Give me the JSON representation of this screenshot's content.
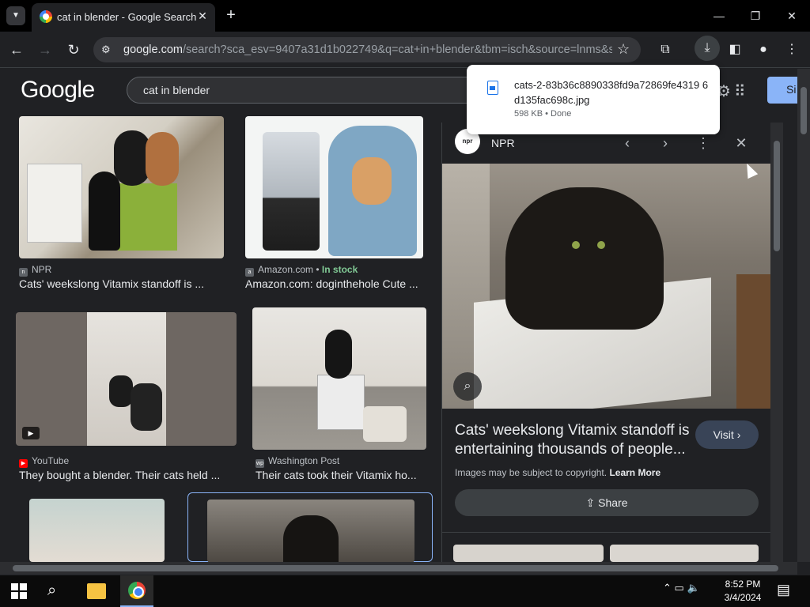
{
  "browser": {
    "tab_title": "cat in blender - Google Search",
    "url_host": "google.com",
    "url_path": "/search?sca_esv=9407a31d1b022749&q=cat+in+blender&tbm=isch&source=lnms&s..."
  },
  "page": {
    "logo": "Google",
    "query": "cat in blender",
    "signin_label": "Si"
  },
  "results": [
    {
      "source": "NPR",
      "source_icon": "npr",
      "caption": "Cats' weekslong Vitamix standoff is ..."
    },
    {
      "source": "Amazon.com",
      "source_icon": "a",
      "stock": "In stock",
      "caption": "Amazon.com: doginthehole Cute ..."
    },
    {
      "source": "YouTube",
      "source_icon": "youtube",
      "caption": "They bought a blender. Their cats held ..."
    },
    {
      "source": "Washington Post",
      "source_icon": "wp",
      "caption": "Their cats took their Vitamix ho..."
    }
  ],
  "panel": {
    "source": "NPR",
    "logo_text": "npr",
    "title": "Cats' weekslong Vitamix standoff is entertaining thousands of people...",
    "visit_label": "Visit",
    "copyright_text": "Images may be subject to copyright.",
    "learn_more": "Learn More",
    "share_label": "Share"
  },
  "download": {
    "filename": "cats-2-83b36c8890338fd9a72869fe4319 6d135fac698c.jpg",
    "status": "598 KB • Done"
  },
  "taskbar": {
    "time": "8:52 PM",
    "date": "3/4/2024"
  },
  "colors": {
    "accent": "#8ab4f8",
    "stock": "#81c995",
    "background": "#202124"
  }
}
